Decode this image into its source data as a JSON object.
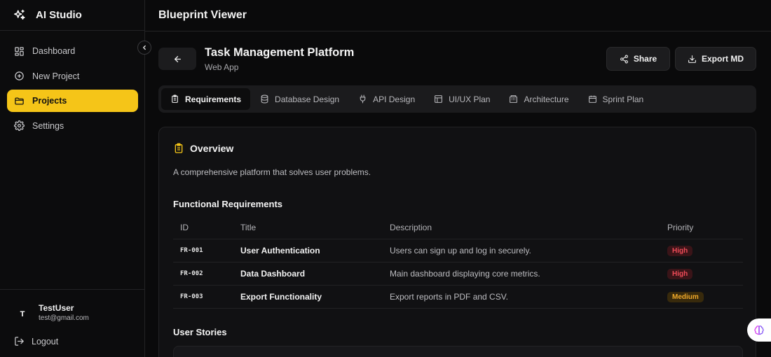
{
  "app": {
    "name": "AI Studio"
  },
  "sidebar": {
    "items": [
      {
        "label": "Dashboard",
        "icon": "grid-icon"
      },
      {
        "label": "New Project",
        "icon": "plus-circle-icon"
      },
      {
        "label": "Projects",
        "icon": "folder-icon",
        "active": true
      },
      {
        "label": "Settings",
        "icon": "gear-icon"
      }
    ],
    "user": {
      "initial": "T",
      "name": "TestUser",
      "email": "test@gmail.com"
    },
    "logout_label": "Logout"
  },
  "header": {
    "title": "Blueprint Viewer"
  },
  "project": {
    "title": "Task Management Platform",
    "subtitle": "Web App",
    "share_label": "Share",
    "export_label": "Export MD"
  },
  "tabs": [
    {
      "label": "Requirements",
      "icon": "clipboard-icon",
      "active": true
    },
    {
      "label": "Database Design",
      "icon": "database-icon"
    },
    {
      "label": "API Design",
      "icon": "plug-icon"
    },
    {
      "label": "UI/UX Plan",
      "icon": "layout-icon"
    },
    {
      "label": "Architecture",
      "icon": "building-icon"
    },
    {
      "label": "Sprint Plan",
      "icon": "calendar-icon"
    }
  ],
  "overview": {
    "heading": "Overview",
    "text": "A comprehensive platform that solves user problems."
  },
  "functional_requirements": {
    "heading": "Functional Requirements",
    "columns": [
      "ID",
      "Title",
      "Description",
      "Priority"
    ],
    "rows": [
      {
        "id": "FR-001",
        "title": "User Authentication",
        "description": "Users can sign up and log in securely.",
        "priority": "High"
      },
      {
        "id": "FR-002",
        "title": "Data Dashboard",
        "description": "Main dashboard displaying core metrics.",
        "priority": "High"
      },
      {
        "id": "FR-003",
        "title": "Export Functionality",
        "description": "Export reports in PDF and CSV.",
        "priority": "Medium"
      }
    ]
  },
  "user_stories": {
    "heading": "User Stories"
  },
  "colors": {
    "accent": "#f5c518",
    "high": "#ef4b58",
    "medium": "#f0a92a"
  }
}
